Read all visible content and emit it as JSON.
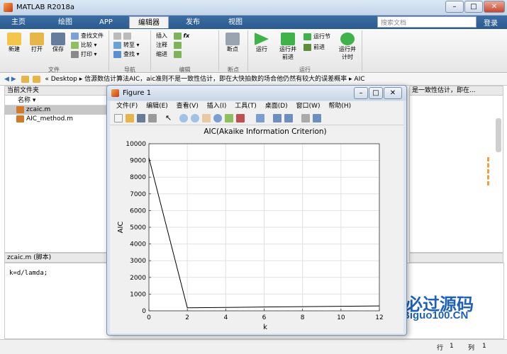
{
  "app": {
    "title": "MATLAB R2018a",
    "login": "登录",
    "search_placeholder": "搜索文档"
  },
  "tabs": [
    {
      "label": "主页"
    },
    {
      "label": "绘图"
    },
    {
      "label": "APP"
    },
    {
      "label": "编辑器"
    },
    {
      "label": "发布"
    },
    {
      "label": "视图"
    }
  ],
  "ribbon": {
    "file": {
      "new": "新建",
      "open": "打开",
      "save": "保存",
      "find_file": "查找文件",
      "compare": "比较",
      "print": "打印",
      "group": "文件"
    },
    "nav": {
      "goto": "转至",
      "find": "查找",
      "group": "导航"
    },
    "edit": {
      "insert": "插入",
      "comment": "注释",
      "indent": "缩进",
      "group": "编辑"
    },
    "breakpoints": {
      "breakpoint": "断点",
      "group": "断点"
    },
    "run": {
      "run": "运行",
      "run_advance": "运行并\n前进",
      "run_section": "运行节",
      "advance": "前进",
      "run_time": "运行并\n计时",
      "group": "运行"
    }
  },
  "address": {
    "path_prefix": "«",
    "path_desktop": "Desktop",
    "path_folder": "信源数估计算法AIC，aic准则不是一致性估计，即在大快拍数的场合他仍然有较大的误差概率",
    "path_leaf": "AIC",
    "right_fragment": "是一致性估计，即在..."
  },
  "current_folder": {
    "title": "当前文件夹",
    "name_col": "名称",
    "files": [
      {
        "name": "zcaic.m"
      },
      {
        "name": "AIC_method.m"
      }
    ]
  },
  "editor": {
    "tab": "zcaic.m  (脚本)",
    "code": "k=d/lamda;"
  },
  "status": {
    "row_label": "行",
    "row": "1",
    "col_label": "列",
    "col": "1"
  },
  "figure": {
    "title": "Figure 1",
    "menus": [
      "文件(F)",
      "编辑(E)",
      "查看(V)",
      "插入(I)",
      "工具(T)",
      "桌面(D)",
      "窗口(W)",
      "帮助(H)"
    ]
  },
  "chart_data": {
    "type": "line",
    "title": "AIC(Akaike Information Criterion)",
    "xlabel": "k",
    "ylabel": "AIC",
    "xlim": [
      0,
      12
    ],
    "ylim": [
      0,
      10000
    ],
    "xticks": [
      0,
      2,
      4,
      6,
      8,
      10,
      12
    ],
    "yticks": [
      0,
      1000,
      2000,
      3000,
      4000,
      5000,
      6000,
      7000,
      8000,
      9000,
      10000
    ],
    "grid": true,
    "series": [
      {
        "x": [
          0,
          2,
          4,
          6,
          8,
          10,
          12
        ],
        "y": [
          9150,
          180,
          200,
          230,
          250,
          270,
          290
        ]
      }
    ]
  },
  "watermark": {
    "text": "必过源码",
    "sub": "Biguo100.CN"
  },
  "colors": {
    "accent": "#2b5a8e",
    "plot_line": "#000000",
    "watermark": "#1f61b8"
  }
}
